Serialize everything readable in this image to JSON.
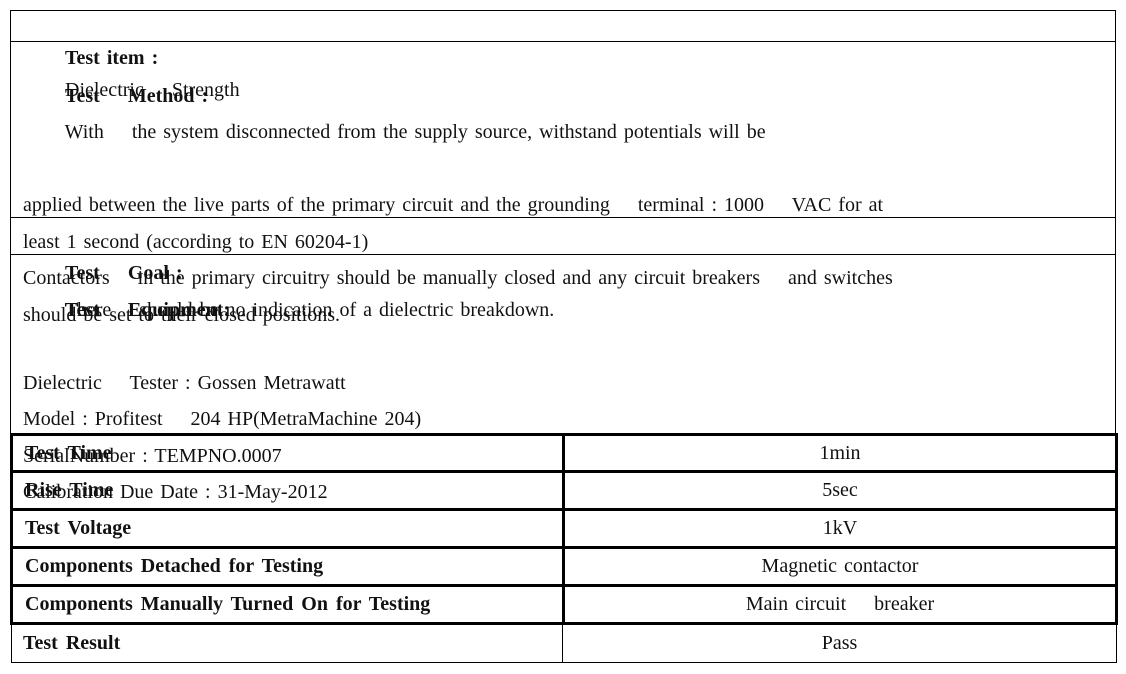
{
  "test_item": {
    "label": "Test item :",
    "value": "Dielectric    Strength"
  },
  "test_method": {
    "label": "Test    Method :",
    "lines": [
      "With    the system disconnected from the supply source, withstand potentials will be",
      "applied between the live parts of the primary circuit and the grounding    terminal : 1000    VAC for at",
      "least 1 second (according to EN 60204-1)",
      "Contactors    in the primary circuitry should be manually closed and any circuit breakers    and switches",
      "should be set to their closed positions."
    ]
  },
  "test_goal": {
    "label": "Test    Goal :",
    "value": "There    should be no indication of a dielectric breakdown."
  },
  "test_equipment": {
    "label": "Test    Equipment:",
    "lines": [
      "Dielectric    Tester : Gossen Metrawatt",
      "Model : Profitest    204 HP(MetraMachine 204)",
      "SerialNumber : TEMPNO.0007",
      "Calibration Due Date : 31-May-2012"
    ]
  },
  "parameters": [
    {
      "label": "Test Time",
      "value": "1min"
    },
    {
      "label": "Rise Time",
      "value": "5sec"
    },
    {
      "label": "Test Voltage",
      "value": "1kV"
    },
    {
      "label": "Components Detached for Testing",
      "value": "Magnetic contactor"
    },
    {
      "label": "Components Manually Turned On for Testing",
      "value": "Main circuit    breaker"
    },
    {
      "label": "Test Result",
      "value": "Pass"
    }
  ]
}
